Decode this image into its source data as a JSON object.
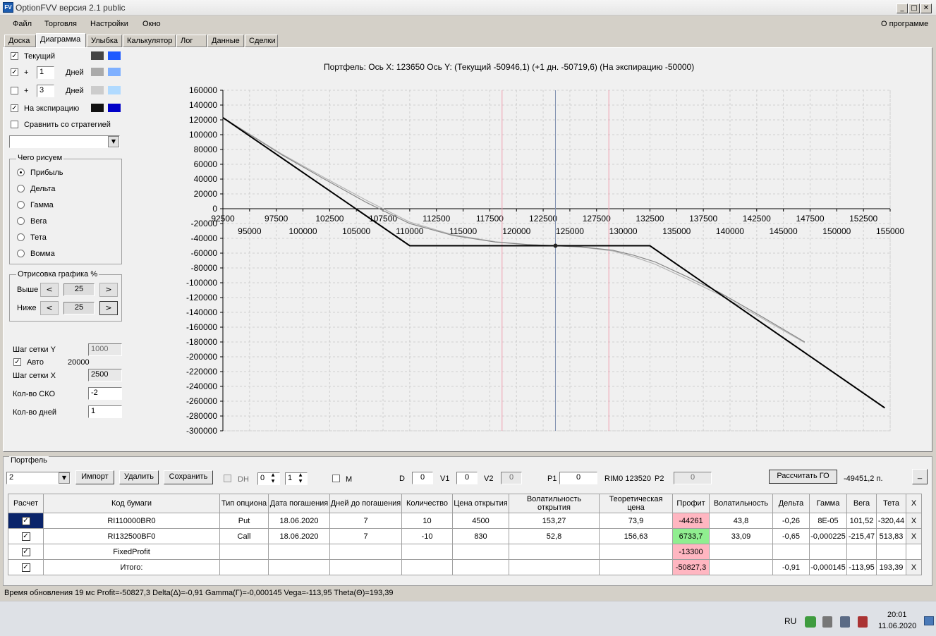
{
  "window": {
    "title": "OptionFVV версия 2.1 public",
    "icon_label": "FV",
    "min_glyph": "_",
    "max_glyph": "□",
    "close_glyph": "✕"
  },
  "menu": {
    "items": [
      "Файл",
      "Торговля",
      "Настройки",
      "Окно"
    ],
    "about": "О программе"
  },
  "tabs": [
    "Доска",
    "Диаграмма",
    "Улыбка",
    "Калькулятор",
    "Лог",
    "Данные",
    "Сделки"
  ],
  "active_tab": "Диаграмма",
  "left_panel": {
    "current_label": "Текущий",
    "plus_label": "+",
    "days_label": "Дней",
    "days1_value": "1",
    "days2_value": "3",
    "expiration_label": "На экспирацию",
    "compare_label": "Сравнить со стратегией",
    "check_glyph": "✓",
    "dropdown_glyph": "▼",
    "colors": {
      "current": [
        "#444444",
        "#1e5aff"
      ],
      "days1": [
        "#aaaaaa",
        "#7fb0ff"
      ],
      "days2": [
        "#cccccc",
        "#b0daff"
      ],
      "expiration": [
        "#111111",
        "#0000c8"
      ]
    },
    "what_to_draw": {
      "title": "Чего рисуем",
      "options": [
        "Прибыль",
        "Дельта",
        "Гамма",
        "Вега",
        "Тета",
        "Вомма"
      ],
      "selected": 0
    },
    "draw_percent": {
      "title": "Отрисовка графика %",
      "above_label": "Выше",
      "above_value": "25",
      "below_label": "Ниже",
      "below_value": "25",
      "left_glyph": "<",
      "right_glyph": ">"
    },
    "grid_y_label": "Шаг сетки Y",
    "grid_y_value": "1000",
    "auto_label": "Авто",
    "auto_value": "20000",
    "grid_x_label": "Шаг сетки X",
    "grid_x_value": "2500",
    "sko_label": "Кол-во СКО",
    "sko_value": "-2",
    "days_count_label": "Кол-во дней",
    "days_count_value": "1"
  },
  "chart_header": "Портфель: Ось X: 123650 Ось Y:  (Текущий -50946,1)  (+1 дн. -50719,6)  (На экспирацию -50000)",
  "chart_data": {
    "type": "line",
    "x_range": [
      92500,
      155000
    ],
    "y_range": [
      -300000,
      160000
    ],
    "y_ticks": [
      160000,
      140000,
      120000,
      100000,
      80000,
      60000,
      40000,
      20000,
      0,
      -20000,
      -40000,
      -60000,
      -80000,
      -100000,
      -120000,
      -140000,
      -160000,
      -180000,
      -200000,
      -220000,
      -240000,
      -260000,
      -280000,
      -300000
    ],
    "x_ticks_upper": [
      92500,
      97500,
      102500,
      107500,
      112500,
      117500,
      122500,
      127500,
      132500,
      137500,
      142500,
      147500,
      152500
    ],
    "x_ticks_lower": [
      95000,
      100000,
      105000,
      110000,
      115000,
      120000,
      125000,
      130000,
      135000,
      140000,
      145000,
      150000,
      155000
    ],
    "current_x": 123650,
    "current_y": -50000,
    "sigma_lines": [
      118650,
      128650
    ],
    "series": [
      {
        "color": "#000000",
        "points": [
          [
            92500,
            123000
          ],
          [
            110000,
            -50000
          ],
          [
            132500,
            -50000
          ],
          [
            154500,
            -269000
          ]
        ]
      },
      {
        "color": "#888888",
        "points": [
          [
            92500,
            123000
          ],
          [
            98000,
            73000
          ],
          [
            102000,
            40000
          ],
          [
            106000,
            8000
          ],
          [
            110000,
            -20000
          ],
          [
            114000,
            -36000
          ],
          [
            118000,
            -45000
          ],
          [
            121000,
            -48500
          ],
          [
            123650,
            -50000
          ],
          [
            126000,
            -51500
          ],
          [
            129000,
            -56000
          ],
          [
            131000,
            -63000
          ],
          [
            133000,
            -72000
          ],
          [
            136000,
            -92000
          ],
          [
            139000,
            -113000
          ],
          [
            143000,
            -146000
          ],
          [
            147000,
            -180000
          ]
        ]
      },
      {
        "color": "#b5b5b5",
        "points": [
          [
            92500,
            123000
          ],
          [
            98000,
            74000
          ],
          [
            102000,
            42000
          ],
          [
            106000,
            11000
          ],
          [
            110000,
            -18000
          ],
          [
            114000,
            -35000
          ],
          [
            118000,
            -44500
          ],
          [
            121000,
            -48300
          ],
          [
            123650,
            -50000
          ],
          [
            126000,
            -51800
          ],
          [
            129000,
            -57000
          ],
          [
            131000,
            -65000
          ],
          [
            133000,
            -75000
          ],
          [
            136000,
            -95000
          ],
          [
            139000,
            -116000
          ],
          [
            143000,
            -148000
          ],
          [
            147000,
            -181000
          ]
        ]
      }
    ]
  },
  "portfolio": {
    "title": "Портфель",
    "selected": "2",
    "import_label": "Импорт",
    "delete_label": "Удалить",
    "save_label": "Сохранить",
    "dh_label": "DH",
    "spin1_value": "0",
    "spin2_value": "1",
    "spin_glyphs": [
      "▲",
      "▼"
    ],
    "m_label": "M",
    "d_label": "D",
    "d_value": "0",
    "v1_label": "V1",
    "v1_value": "0",
    "v2_label": "V2",
    "v2_value": "0",
    "p1_label": "P1",
    "p1_value": "0",
    "rim_label": "RIM0 123520",
    "p2_label": "P2",
    "p2_value": "0",
    "calc_go_label": "Рассчитать ГО",
    "go_value": "-49451,2 п.",
    "minimize_label": "_",
    "columns": [
      "Расчет",
      "Код бумаги",
      "Тип опциона",
      "Дата погашения",
      "Дней до погашения",
      "Количество",
      "Цена открытия",
      "Волатильность открытия",
      "Теоретическая цена",
      "Профит",
      "Волатильность",
      "Дельта",
      "Гамма",
      "Вега",
      "Тета",
      "X"
    ],
    "rows": [
      [
        "✓",
        "RI110000BR0",
        "Put",
        "18.06.2020",
        "7",
        "10",
        "4500",
        "153,27",
        "73,9",
        "-44261",
        "43,8",
        "-0,26",
        "8E-05",
        "101,52",
        "-320,44",
        "X"
      ],
      [
        "✓",
        "RI132500BF0",
        "Call",
        "18.06.2020",
        "7",
        "-10",
        "830",
        "52,8",
        "156,63",
        "6733,7",
        "33,09",
        "-0,65",
        "-0,000225",
        "-215,47",
        "513,83",
        "X"
      ],
      [
        "✓",
        "FixedProfit",
        "",
        "",
        "",
        "",
        "",
        "",
        "",
        "-13300",
        "",
        "",
        "",
        "",
        "",
        ""
      ],
      [
        "✓",
        "Итого:",
        "",
        "",
        "",
        "",
        "",
        "",
        "",
        "-50827,3",
        "",
        "-0,91",
        "-0,000145",
        "-113,95",
        "193,39",
        "X"
      ]
    ]
  },
  "status": "Время обновления 19 мс  Profit=-50827,3 Delta(Δ)=-0,91 Gamma(Γ)=-0,000145 Vega=-113,95 Theta(Θ)=193,39",
  "taskbar": {
    "lang": "RU",
    "time": "20:01",
    "date": "11.06.2020"
  }
}
